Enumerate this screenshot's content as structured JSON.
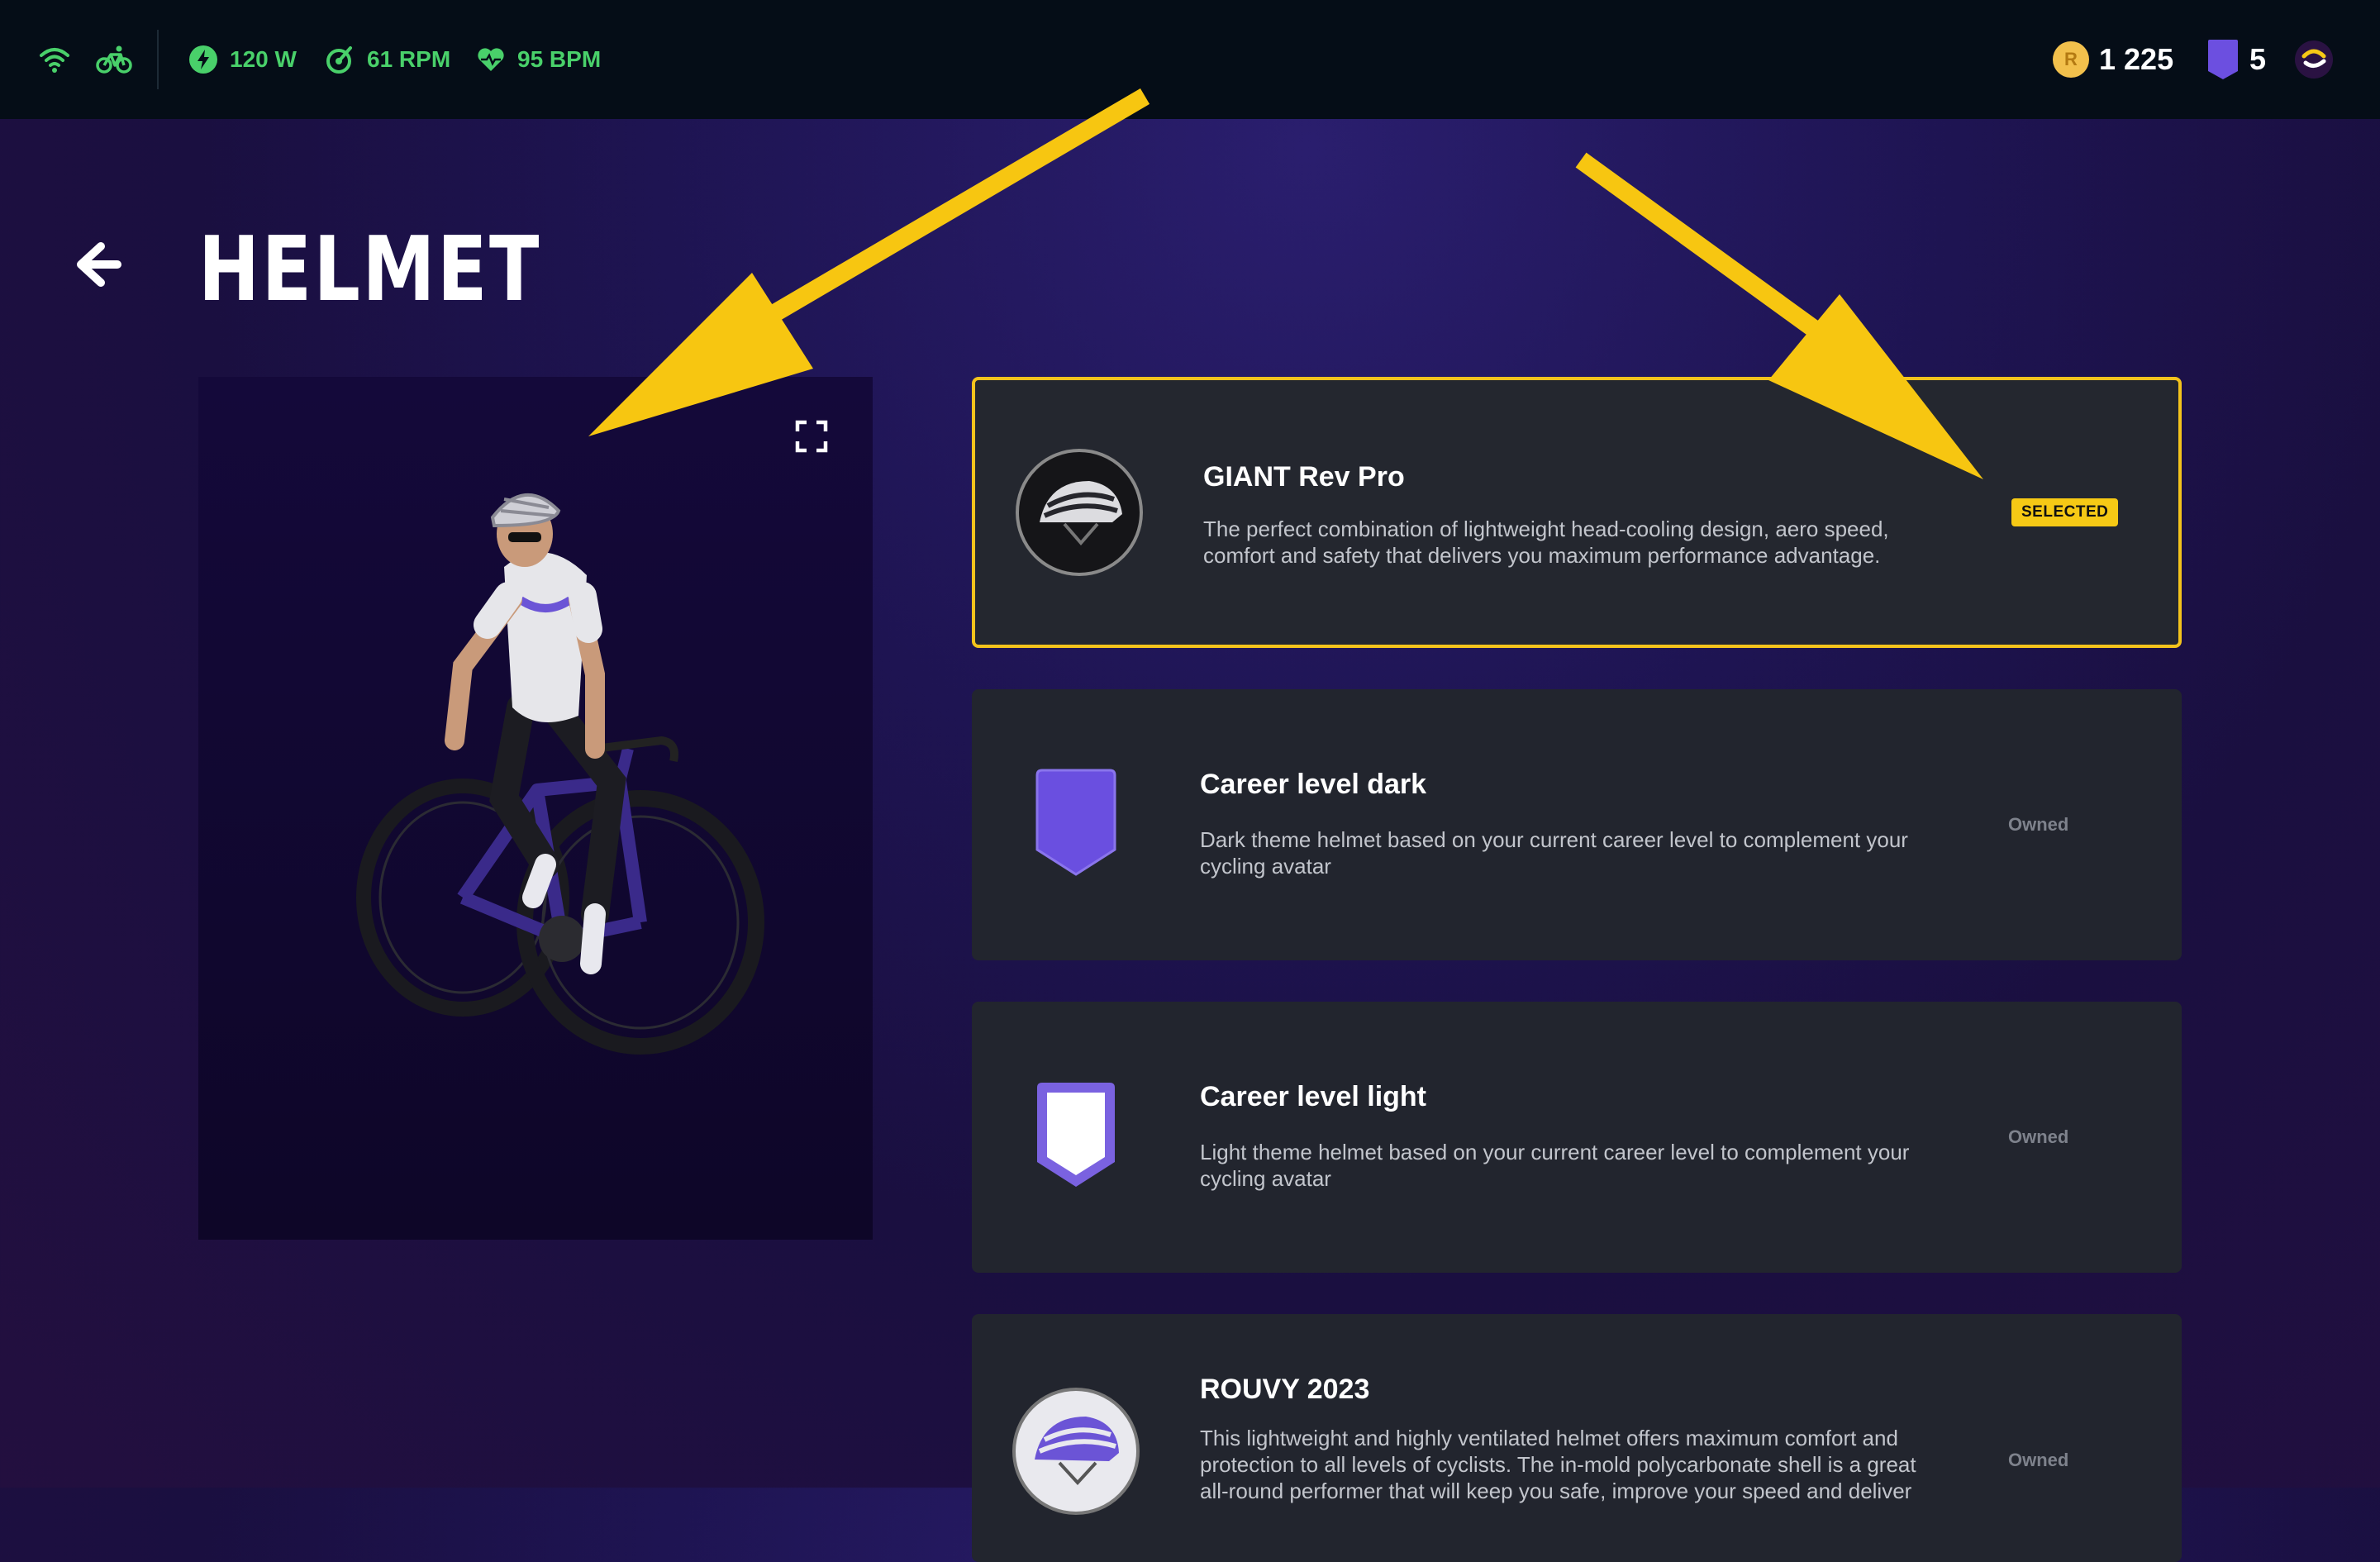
{
  "topbar": {
    "power": "120 W",
    "cadence": "61 RPM",
    "heart_rate": "95 BPM",
    "coins": "1 225",
    "level": "5",
    "coin_symbol": "R",
    "icons": [
      "wifi-icon",
      "bike-icon",
      "power-icon",
      "cadence-icon",
      "heart-rate-icon",
      "coin-icon",
      "career-badge-icon",
      "rouvy-logo-icon"
    ],
    "metric_color": "#49d06a"
  },
  "header": {
    "title": "HELMET",
    "back_icon": "arrow-left-icon"
  },
  "preview": {
    "fullscreen_icon": "fullscreen-icon"
  },
  "items": [
    {
      "title": "GIANT Rev Pro",
      "description": "The perfect combination of lightweight head-cooling design, aero speed, comfort and safety that delivers you maximum performance advantage.",
      "status": "SELECTED",
      "icon": "helmet-giant-icon"
    },
    {
      "title": "Career level dark",
      "description": "Dark theme helmet based on your current career level to complement your cycling avatar",
      "status": "Owned",
      "icon": "career-dark-shield-icon"
    },
    {
      "title": "Career level light",
      "description": "Light theme helmet based on your current career level to complement your cycling avatar",
      "status": "Owned",
      "icon": "career-light-shield-icon"
    },
    {
      "title": "ROUVY 2023",
      "description": "This lightweight and highly ventilated helmet offers maximum comfort and protection to all levels of cyclists. The in-mold polycarbonate shell is a great all-round performer that will keep you safe, improve your speed and deliver",
      "status": "Owned",
      "icon": "helmet-rouvy-icon"
    }
  ],
  "colors": {
    "accent": "#f3c31c",
    "card_bg": "#22252e",
    "topbar_bg": "#050d17"
  }
}
